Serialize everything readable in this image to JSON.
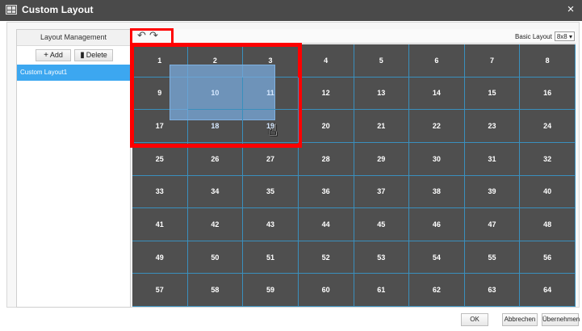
{
  "window": {
    "title": "Custom Layout",
    "close_glyph": "×"
  },
  "layout_panel": {
    "header": "Layout Management",
    "add_label": "Add",
    "add_icon": "+",
    "delete_label": "Delete",
    "delete_icon": "▮",
    "items": [
      "Custom Layout1"
    ]
  },
  "toolbar": {
    "undo_glyph": "↶",
    "redo_glyph": "↷",
    "basic_layout_label": "Basic Layout",
    "basic_layout_value": "8x8 ▾"
  },
  "grid": {
    "rows": 8,
    "cols": 8,
    "cells": [
      "1",
      "2",
      "3",
      "4",
      "5",
      "6",
      "7",
      "8",
      "9",
      "10",
      "11",
      "12",
      "13",
      "14",
      "15",
      "16",
      "17",
      "18",
      "19",
      "20",
      "21",
      "22",
      "23",
      "24",
      "25",
      "26",
      "27",
      "28",
      "29",
      "30",
      "31",
      "32",
      "33",
      "34",
      "35",
      "36",
      "37",
      "38",
      "39",
      "40",
      "41",
      "42",
      "43",
      "44",
      "45",
      "46",
      "47",
      "48",
      "49",
      "50",
      "51",
      "52",
      "53",
      "54",
      "55",
      "56",
      "57",
      "58",
      "59",
      "60",
      "61",
      "62",
      "63",
      "64"
    ],
    "selected_cells": [
      "10",
      "11",
      "18",
      "19"
    ]
  },
  "footer": {
    "ok_label": "OK",
    "cancel_label": "Abbrechen",
    "apply_label": "Übernehmen"
  },
  "colors": {
    "titlebar": "#4a4a4a",
    "grid_bg": "#4f4f4f",
    "grid_line": "#3a8fbd",
    "list_selected": "#3ca7f0",
    "highlight": "#ff0000",
    "selection": "#78aadc"
  }
}
